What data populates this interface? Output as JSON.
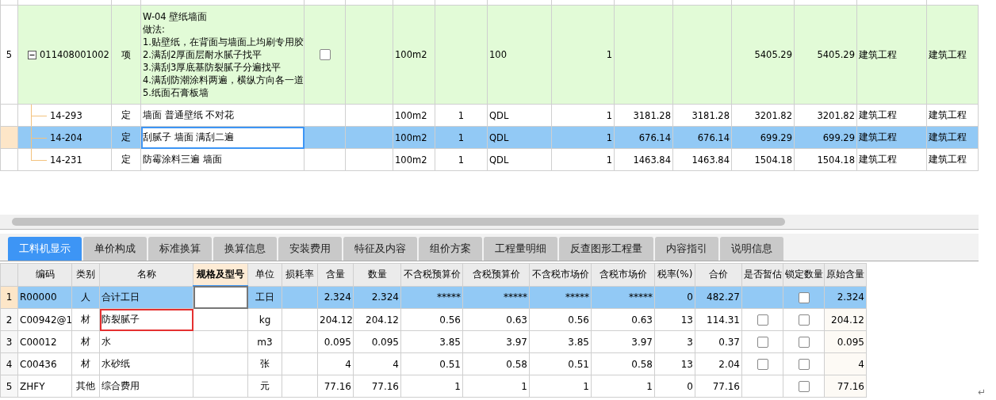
{
  "top_table": {
    "rows": [
      {
        "number": "5",
        "code": "011408001002",
        "type": "项",
        "expanded": true,
        "name_lines": [
          "W-04 壁纸墙面",
          "做法:",
          "1.贴壁纸，在背面与墙面上均刷专用胶",
          "2.满刮2厚面层耐水腻子找平",
          "3.满刮3厚底基防裂腻子分遍找平",
          "4.满刮防潮涂料两遍，横纵方向各一道",
          "5.纸面石膏板墙"
        ],
        "checkbox": {
          "checked": false
        },
        "unit": "100m2",
        "column_8": "100",
        "column_9": "1",
        "column_12": "5405.29",
        "column_13": "5405.29",
        "column_14": "建筑工程",
        "column_15": "建筑工程",
        "children": [
          {
            "code": "14-293",
            "type": "定",
            "name": "墙面 普通壁纸 不对花",
            "selected": false,
            "editing": false,
            "unit": "100m2",
            "column_7": "1",
            "column_8": "QDL",
            "column_9": "1",
            "column_10": "3181.28",
            "column_11": "3181.28",
            "column_12": "3201.82",
            "column_13": "3201.82",
            "column_14": "建筑工程",
            "column_15": "建筑工程"
          },
          {
            "code": "14-204",
            "type": "定",
            "name": "刮腻子 墙面 满刮二遍",
            "selected": true,
            "editing": true,
            "unit": "100m2",
            "column_7": "1",
            "column_8": "QDL",
            "column_9": "1",
            "column_10": "676.14",
            "column_11": "676.14",
            "column_12": "699.29",
            "column_13": "699.29",
            "column_14": "建筑工程",
            "column_15": "建筑工程"
          },
          {
            "code": "14-231",
            "type": "定",
            "name": "防霉涂料三遍 墙面",
            "selected": false,
            "editing": false,
            "unit": "100m2",
            "column_7": "1",
            "column_8": "QDL",
            "column_9": "1",
            "column_10": "1463.84",
            "column_11": "1463.84",
            "column_12": "1504.18",
            "column_13": "1504.18",
            "column_14": "建筑工程",
            "column_15": "建筑工程"
          }
        ]
      }
    ]
  },
  "tabs": [
    {
      "label": "工料机显示",
      "selected": true
    },
    {
      "label": "单价构成",
      "selected": false
    },
    {
      "label": "标准换算",
      "selected": false
    },
    {
      "label": "换算信息",
      "selected": false
    },
    {
      "label": "安装费用",
      "selected": false
    },
    {
      "label": "特征及内容",
      "selected": false
    },
    {
      "label": "组价方案",
      "selected": false
    },
    {
      "label": "工程量明细",
      "selected": false
    },
    {
      "label": "反查图形工程量",
      "selected": false
    },
    {
      "label": "内容指引",
      "selected": false
    },
    {
      "label": "说明信息",
      "selected": false
    }
  ],
  "bottom_table": {
    "columns": [
      {
        "label": "编码",
        "selected": false
      },
      {
        "label": "类别",
        "selected": false
      },
      {
        "label": "名称",
        "selected": false
      },
      {
        "label": "规格及型号",
        "selected": true
      },
      {
        "label": "单位",
        "selected": false
      },
      {
        "label": "损耗率",
        "selected": false
      },
      {
        "label": "含量",
        "selected": false
      },
      {
        "label": "数量",
        "selected": false
      },
      {
        "label": "不含税预算价",
        "selected": false
      },
      {
        "label": "含税预算价",
        "selected": false
      },
      {
        "label": "不含税市场价",
        "selected": false
      },
      {
        "label": "含税市场价",
        "selected": false
      },
      {
        "label": "税率(%)",
        "selected": false
      },
      {
        "label": "合价",
        "selected": false
      },
      {
        "label": "是否暂估",
        "selected": false
      },
      {
        "label": "锁定数量",
        "selected": false
      },
      {
        "label": "原始含量",
        "selected": false
      }
    ],
    "rows": [
      {
        "number": "1",
        "selected": true,
        "code": "R00000",
        "category": "人",
        "name": "合计工日",
        "name_outlined": false,
        "spec_editing": true,
        "unit": "工日",
        "content": "2.324",
        "quantity": "2.324",
        "budget_price": "*****",
        "budget_price_tax": "*****",
        "market_price": "*****",
        "market_price_tax": "*****",
        "tax_rate": "0",
        "total": "482.27",
        "lock": {
          "checked": false
        },
        "original": "2.324"
      },
      {
        "number": "2",
        "selected": false,
        "code": "C00942@1",
        "category": "材",
        "name": "防裂腻子",
        "name_outlined": true,
        "spec_editing": false,
        "unit": "kg",
        "content": "204.12",
        "quantity": "204.12",
        "budget_price": "0.56",
        "budget_price_tax": "0.63",
        "market_price": "0.56",
        "market_price_tax": "0.63",
        "tax_rate": "13",
        "total": "114.31",
        "estimate": {
          "checked": false
        },
        "lock": {
          "checked": false
        },
        "original": "204.12"
      },
      {
        "number": "3",
        "selected": false,
        "code": "C00012",
        "category": "材",
        "name": "水",
        "name_outlined": false,
        "spec_editing": false,
        "unit": "m3",
        "content": "0.095",
        "quantity": "0.095",
        "budget_price": "3.85",
        "budget_price_tax": "3.97",
        "market_price": "3.85",
        "market_price_tax": "3.97",
        "tax_rate": "3",
        "total": "0.37",
        "estimate": {
          "checked": false
        },
        "lock": {
          "checked": false
        },
        "original": "0.095"
      },
      {
        "number": "4",
        "selected": false,
        "code": "C00436",
        "category": "材",
        "name": "水砂纸",
        "name_outlined": false,
        "spec_editing": false,
        "unit": "张",
        "content": "4",
        "quantity": "4",
        "budget_price": "0.51",
        "budget_price_tax": "0.58",
        "market_price": "0.51",
        "market_price_tax": "0.58",
        "tax_rate": "13",
        "total": "2.04",
        "estimate": {
          "checked": false
        },
        "lock": {
          "checked": false
        },
        "original": "4"
      },
      {
        "number": "5",
        "selected": false,
        "code": "ZHFY",
        "category": "其他",
        "name": "综合费用",
        "name_outlined": false,
        "spec_editing": false,
        "unit": "元",
        "content": "77.16",
        "quantity": "77.16",
        "budget_price": "1",
        "budget_price_tax": "1",
        "market_price": "1",
        "market_price_tax": "1",
        "tax_rate": "0",
        "total": "77.16",
        "lock": {
          "checked": false
        },
        "original": "77.16"
      }
    ]
  },
  "return_mark": "↵"
}
